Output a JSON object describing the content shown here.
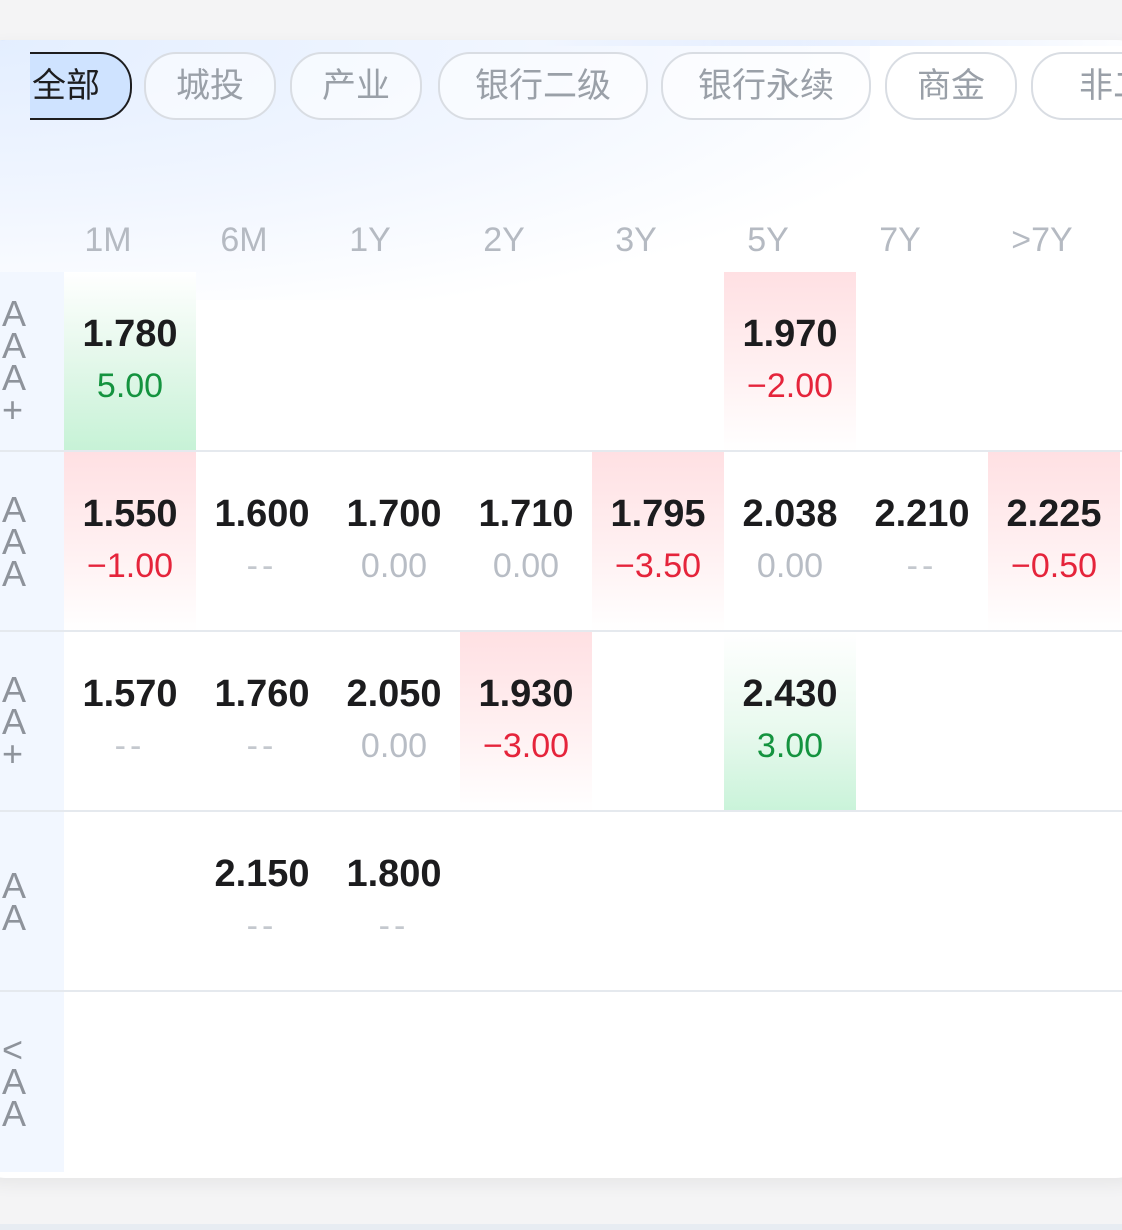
{
  "tabs": [
    "全部",
    "城投",
    "产业",
    "银行二级",
    "银行永续",
    "商金",
    "非二"
  ],
  "active_tab": "全部",
  "columns": [
    "1M",
    "6M",
    "1Y",
    "2Y",
    "3Y",
    "5Y",
    "7Y",
    ">7Y"
  ],
  "rows": [
    {
      "label": [
        "A",
        "A",
        "A",
        "+"
      ],
      "cells": [
        {
          "v": "1.780",
          "c": "5.00",
          "t": "pos"
        },
        null,
        null,
        null,
        null,
        {
          "v": "1.970",
          "c": "−2.00",
          "t": "neg"
        },
        null,
        null
      ]
    },
    {
      "label": [
        "A",
        "A",
        "A"
      ],
      "cells": [
        {
          "v": "1.550",
          "c": "−1.00",
          "t": "neg"
        },
        {
          "v": "1.600",
          "c": "--",
          "t": "none"
        },
        {
          "v": "1.700",
          "c": "0.00",
          "t": "zero"
        },
        {
          "v": "1.710",
          "c": "0.00",
          "t": "zero"
        },
        {
          "v": "1.795",
          "c": "−3.50",
          "t": "neg"
        },
        {
          "v": "2.038",
          "c": "0.00",
          "t": "zero"
        },
        {
          "v": "2.210",
          "c": "--",
          "t": "none"
        },
        {
          "v": "2.225",
          "c": "−0.50",
          "t": "neg"
        }
      ]
    },
    {
      "label": [
        "A",
        "A",
        "+"
      ],
      "cells": [
        {
          "v": "1.570",
          "c": "--",
          "t": "none"
        },
        {
          "v": "1.760",
          "c": "--",
          "t": "none"
        },
        {
          "v": "2.050",
          "c": "0.00",
          "t": "zero"
        },
        {
          "v": "1.930",
          "c": "−3.00",
          "t": "neg"
        },
        null,
        {
          "v": "2.430",
          "c": "3.00",
          "t": "pos"
        },
        null,
        null
      ]
    },
    {
      "label": [
        "A",
        "A"
      ],
      "cells": [
        null,
        {
          "v": "2.150",
          "c": "--",
          "t": "none"
        },
        {
          "v": "1.800",
          "c": "--",
          "t": "none"
        },
        null,
        null,
        null,
        null,
        null
      ]
    },
    {
      "label": [
        "<",
        "A",
        "A"
      ],
      "cells": [
        null,
        null,
        null,
        null,
        null,
        null,
        null,
        null
      ]
    }
  ],
  "colors": {
    "up_bg": "#ffe0e3",
    "down_bg": "#c9f3d9",
    "negative_text": "#e5243b",
    "positive_text": "#14933f",
    "active_chip_bg": "#cfe3ff"
  }
}
